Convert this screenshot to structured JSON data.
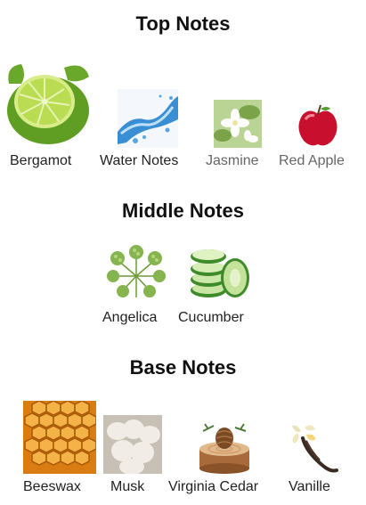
{
  "top_notes": {
    "title": "Top Notes",
    "items": [
      {
        "label": "Bergamot",
        "icon": "bergamot-lime-icon"
      },
      {
        "label": "Water Notes",
        "icon": "water-splash-icon"
      },
      {
        "label": "Jasmine",
        "icon": "jasmine-flower-icon"
      },
      {
        "label": "Red Apple",
        "icon": "red-apple-icon"
      }
    ]
  },
  "middle_notes": {
    "title": "Middle Notes",
    "items": [
      {
        "label": "Angelica",
        "icon": "angelica-plant-icon"
      },
      {
        "label": "Cucumber",
        "icon": "cucumber-slices-icon"
      }
    ]
  },
  "base_notes": {
    "title": "Base Notes",
    "items": [
      {
        "label": "Beeswax",
        "icon": "honeycomb-icon"
      },
      {
        "label": "Musk",
        "icon": "musk-cotton-icon"
      },
      {
        "label": "Virginia Cedar",
        "icon": "cedar-log-icon"
      },
      {
        "label": "Vanille",
        "icon": "vanilla-flower-icon"
      }
    ]
  }
}
